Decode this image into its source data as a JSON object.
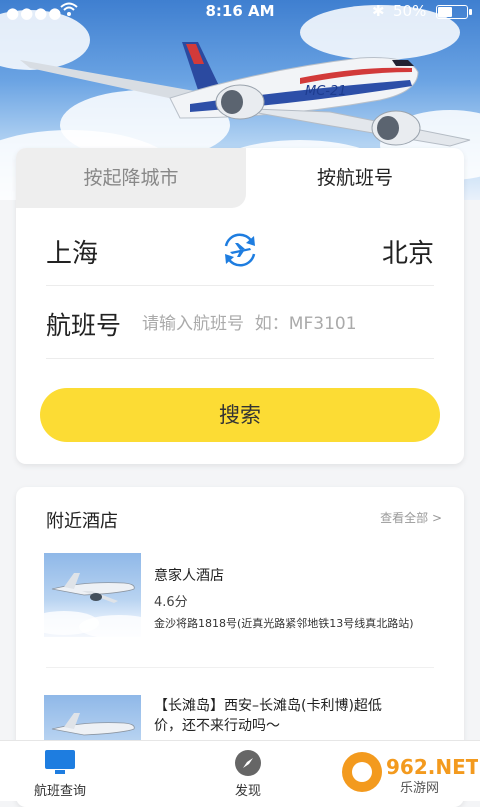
{
  "status_bar": {
    "signal": "●●●●",
    "time": "8:16 AM",
    "bluetooth": "✱",
    "battery_text": "50%",
    "battery_level": 0.5
  },
  "hero": {
    "plane_label": "MC-21"
  },
  "search": {
    "tabs": [
      {
        "label": "按起降城市",
        "active": false
      },
      {
        "label": "按航班号",
        "active": true
      }
    ],
    "from_city": "上海",
    "to_city": "北京",
    "flight_label": "航班号",
    "flight_placeholder": "请输入航班号  如：MF3101",
    "flight_value": "",
    "search_button": "搜索"
  },
  "nearby": {
    "title": "附近酒店",
    "view_all": "查看全部 >",
    "items": [
      {
        "name": "意家人酒店",
        "score": "4.6分",
        "address": "金沙将路1818号(近真光路紧邻地铁13号线真北路站)"
      },
      {
        "name_line1": "【长滩岛】西安–长滩岛(卡利博)超低",
        "name_line2": "价，还不来行动吗～"
      }
    ]
  },
  "bottom_nav": [
    {
      "label": "航班查询",
      "icon": "monitor-icon",
      "color": "#1e7de0"
    },
    {
      "label": "发现",
      "icon": "compass-icon",
      "color": "#666666"
    }
  ],
  "watermark": {
    "brand": "962.NET",
    "sub": "乐游网"
  },
  "colors": {
    "accent_yellow": "#fcdc34",
    "accent_blue": "#1e7de0"
  }
}
